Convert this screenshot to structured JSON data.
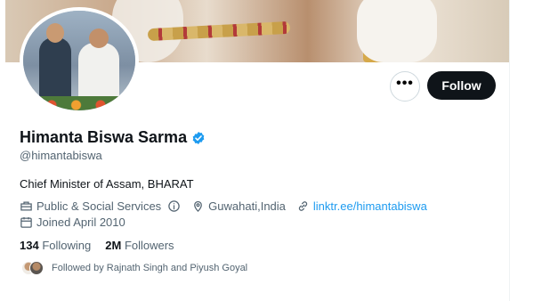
{
  "profile": {
    "name": "Himanta Biswa Sarma",
    "handle": "@himantabiswa",
    "bio": "Chief Minister of Assam, BHARAT",
    "category": "Public & Social Services",
    "location": "Guwahati,India",
    "link": "linktr.ee/himantabiswa",
    "joined": "Joined April 2010",
    "verified": true
  },
  "actions": {
    "more_label": "•••",
    "follow_label": "Follow"
  },
  "stats": {
    "following_count": "134",
    "following_label": "Following",
    "followers_count": "2M",
    "followers_label": "Followers"
  },
  "followed_by": "Followed by Rajnath Singh and Piyush Goyal",
  "icons": {
    "category": "briefcase-icon",
    "info": "info-icon",
    "location": "location-pin-icon",
    "link": "link-icon",
    "joined": "calendar-icon",
    "verified": "verified-badge-icon",
    "more": "more-options-icon"
  },
  "colors": {
    "verified": "#1d9bf0",
    "link": "#1d9bf0",
    "follow_button": "#0f1419",
    "secondary_text": "#536471"
  }
}
